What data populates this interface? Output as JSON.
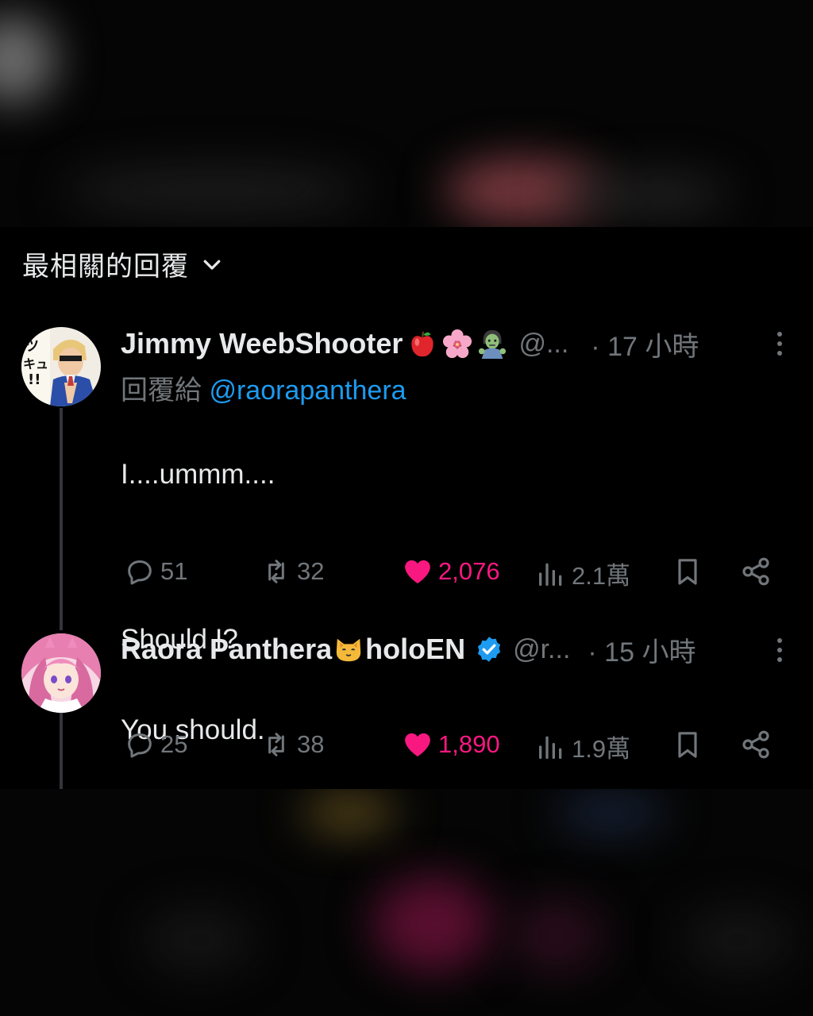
{
  "sort": {
    "label": "最相關的回覆",
    "icon": "chevron-down-icon"
  },
  "replies": [
    {
      "name": "Jimmy WeebShooter",
      "name_emojis": [
        "red-apple-emoji",
        "cherry-blossom-emoji",
        "zombie-emoji"
      ],
      "handle": "@...",
      "time": "· 17 小時",
      "reply_to_prefix": "回覆給",
      "reply_to_handle": "@raorapanthera",
      "text_line1": "I....ummm....",
      "text_line2": "Should I?",
      "stats": {
        "replies": "51",
        "reposts": "32",
        "likes": "2,076",
        "views": "2.1萬"
      }
    },
    {
      "name": "Raora Panthera",
      "name_emojis": [
        "cat-emoji"
      ],
      "name_suffix": "holoEN",
      "verified": true,
      "handle": "@r...",
      "time": "· 15 小時",
      "text_line1": "You should.",
      "stats": {
        "replies": "25",
        "reposts": "38",
        "likes": "1,890",
        "views": "1.9萬"
      }
    }
  ],
  "colors": {
    "accent_blue": "#1d9bf0",
    "like_pink": "#f91880",
    "muted": "#71767b",
    "text": "#e7e9ea"
  }
}
